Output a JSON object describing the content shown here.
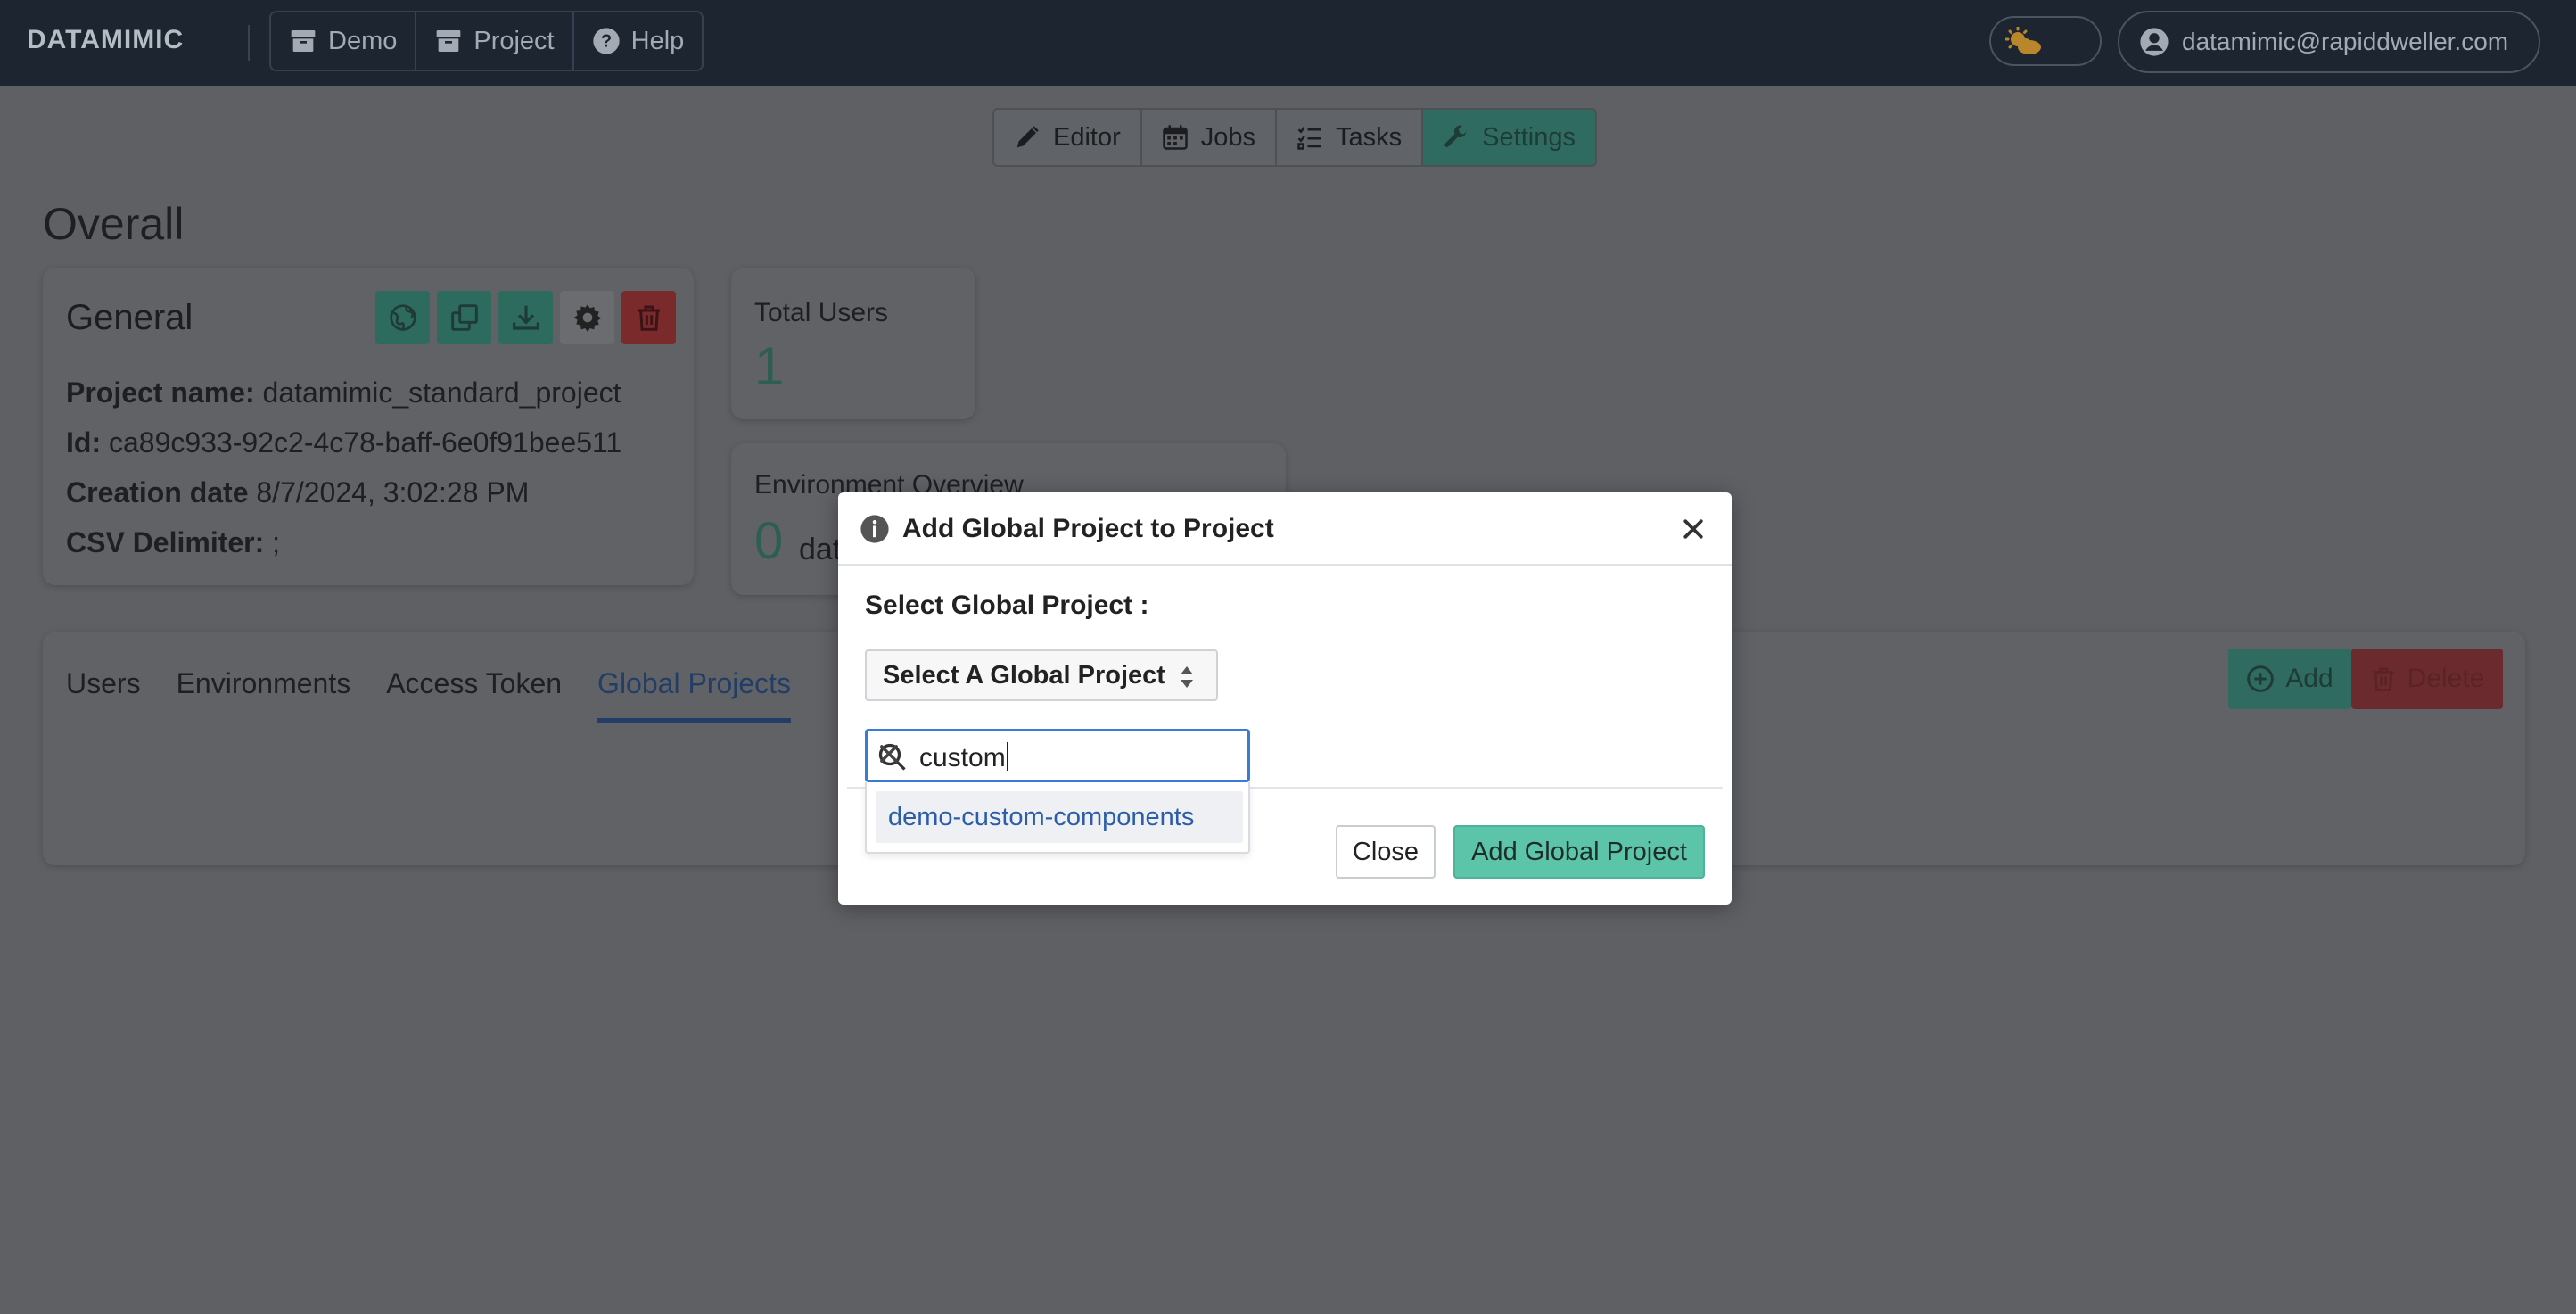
{
  "navbar": {
    "brand": "DATAMIMIC",
    "links": [
      {
        "label": "Demo",
        "icon": "archive-icon"
      },
      {
        "label": "Project",
        "icon": "archive-icon"
      },
      {
        "label": "Help",
        "icon": "question-circle-icon"
      }
    ],
    "theme_toggle_icon": "sun-cloud-icon",
    "user_email": "datamimic@rapiddweller.com"
  },
  "page_tabs": [
    {
      "label": "Editor",
      "icon": "pencil-icon",
      "active": false
    },
    {
      "label": "Jobs",
      "icon": "calendar-icon",
      "active": false
    },
    {
      "label": "Tasks",
      "icon": "tasks-icon",
      "active": false
    },
    {
      "label": "Settings",
      "icon": "wrench-icon",
      "active": true
    }
  ],
  "overall": {
    "title": "Overall",
    "general": {
      "title": "General",
      "actions": [
        "globe-icon",
        "copy-icon",
        "download-icon",
        "gear-icon",
        "trash-icon"
      ],
      "project_name_label": "Project name:",
      "project_name": "datamimic_standard_project",
      "id_label": "Id:",
      "id": "ca89c933-92c2-4c78-baff-6e0f91bee511",
      "creation_date_label": "Creation date",
      "creation_date": "8/7/2024, 3:02:28 PM",
      "csv_delimiter_label": "CSV Delimiter:",
      "csv_delimiter": ";"
    },
    "total_users": {
      "label": "Total Users",
      "value": "1"
    },
    "environment_overview": {
      "label": "Environment Overview",
      "value": "0",
      "suffix": "dat"
    }
  },
  "settings_tabs": {
    "tabs": [
      "Users",
      "Environments",
      "Access Token",
      "Global Projects"
    ],
    "active_tab": "Global Projects",
    "add_label": "Add",
    "delete_label": "Delete"
  },
  "modal": {
    "title": "Add Global Project to Project",
    "field_label": "Select Global Project :",
    "select_placeholder": "Select A Global Project",
    "search_value": "custom",
    "options": [
      "demo-custom-components"
    ],
    "close_label": "Close",
    "submit_label": "Add Global Project"
  },
  "colors": {
    "navbar": "#1c2530",
    "overlay": "#5e6064",
    "primary": "#5cc4a9",
    "danger": "#dc3545",
    "link": "#2c5da8"
  }
}
